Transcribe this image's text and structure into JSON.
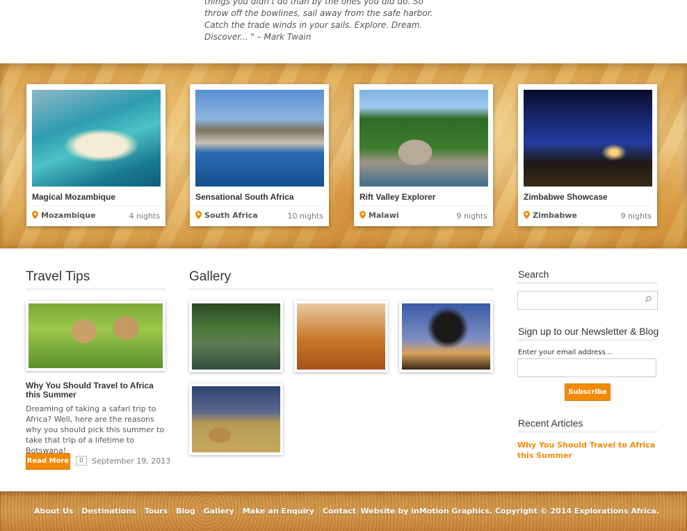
{
  "quote": {
    "text": "things you didn't do than by the ones you did do. So throw off the bowlines, sail away from the safe harbor. Catch the trade winds in your sails. Explore. Dream. Discover... \" – Mark Twain"
  },
  "featured": [
    {
      "title": "Magical Mozambique",
      "location": "Mozambique",
      "nights": "4 nights"
    },
    {
      "title": "Sensational South Africa",
      "location": "South Africa",
      "nights": "10 nights"
    },
    {
      "title": "Rift Valley Explorer",
      "location": "Malawi",
      "nights": "9 nights"
    },
    {
      "title": "Zimbabwe Showcase",
      "location": "Zimbabwe",
      "nights": "9 nights"
    }
  ],
  "travel_tips": {
    "heading": "Travel Tips",
    "post_title": "Why You Should Travel to Africa this Summer",
    "post_excerpt": "Dreaming of taking a safari trip to Africa? Well, here are the reasons why you should pick this summer to take that trip of a lifetime to Botswana!",
    "read_more": "Read More",
    "comments": "0",
    "date": "September 19, 2013"
  },
  "gallery": {
    "heading": "Gallery"
  },
  "sidebar": {
    "search_heading": "Search",
    "search_placeholder": "",
    "newsletter_heading": "Sign up to our Newsletter & Blog",
    "email_label": "Enter your email address...",
    "email_value": "",
    "subscribe": "Subscribe",
    "recent_heading": "Recent Articles",
    "recent_items": [
      "Why You Should Travel to Africa this Summer"
    ]
  },
  "footer": {
    "nav": [
      "About Us",
      "Destinations",
      "Tours",
      "Blog",
      "Gallery",
      "Make an Enquiry",
      "Contact"
    ],
    "copyright": "Website by inMotion Graphics. Copyright © 2014 Explorations Africa."
  },
  "colors": {
    "accent": "#f28a0a"
  }
}
